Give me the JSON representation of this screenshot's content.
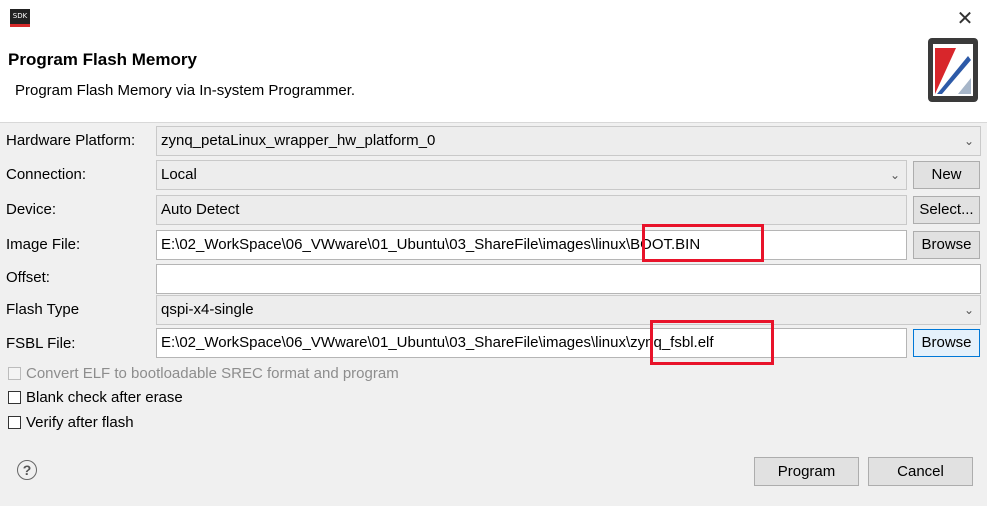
{
  "window": {
    "app_icon_text": "SDK",
    "close_glyph": "✕"
  },
  "header": {
    "title": "Program Flash Memory",
    "description": "Program Flash Memory via In-system Programmer."
  },
  "form": {
    "hardware_platform": {
      "label": "Hardware Platform:",
      "value": "zynq_petaLinux_wrapper_hw_platform_0"
    },
    "connection": {
      "label": "Connection:",
      "value": "Local",
      "button": "New"
    },
    "device": {
      "label": "Device:",
      "value": "Auto Detect",
      "button": "Select..."
    },
    "image_file": {
      "label": "Image File:",
      "value": "E:\\02_WorkSpace\\06_VWware\\01_Ubuntu\\03_ShareFile\\images\\linux\\BOOT.BIN",
      "button": "Browse"
    },
    "offset": {
      "label": "Offset:",
      "value": ""
    },
    "flash_type": {
      "label": "Flash Type",
      "value": "qspi-x4-single"
    },
    "fsbl_file": {
      "label": "FSBL File:",
      "value": "E:\\02_WorkSpace\\06_VWware\\01_Ubuntu\\03_ShareFile\\images\\linux\\zynq_fsbl.elf",
      "button": "Browse"
    }
  },
  "options": {
    "convert_elf": {
      "label": "Convert ELF to bootloadable SREC format and program",
      "checked": false,
      "disabled": true
    },
    "blank_check": {
      "label": "Blank check after erase",
      "checked": false
    },
    "verify": {
      "label": "Verify after flash",
      "checked": false
    }
  },
  "footer": {
    "help_glyph": "?",
    "program_button": "Program",
    "cancel_button": "Cancel"
  },
  "colors": {
    "highlight_box": "#e8132a",
    "focus_border": "#0078d7"
  }
}
